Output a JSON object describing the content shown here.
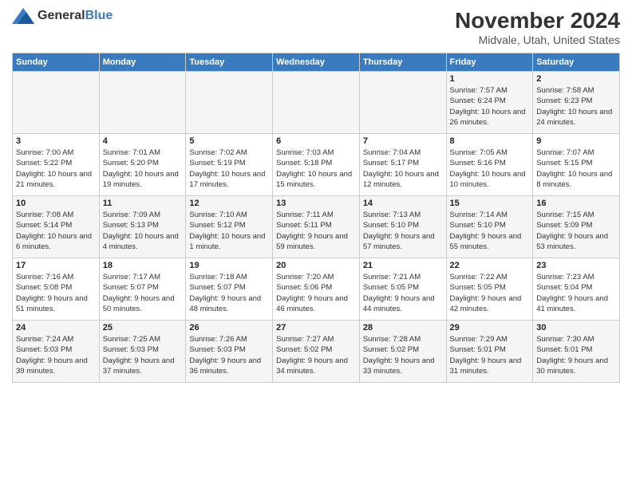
{
  "header": {
    "logo_general": "General",
    "logo_blue": "Blue",
    "month_year": "November 2024",
    "location": "Midvale, Utah, United States"
  },
  "days_of_week": [
    "Sunday",
    "Monday",
    "Tuesday",
    "Wednesday",
    "Thursday",
    "Friday",
    "Saturday"
  ],
  "weeks": [
    [
      {
        "day": "",
        "sunrise": "",
        "sunset": "",
        "daylight": ""
      },
      {
        "day": "",
        "sunrise": "",
        "sunset": "",
        "daylight": ""
      },
      {
        "day": "",
        "sunrise": "",
        "sunset": "",
        "daylight": ""
      },
      {
        "day": "",
        "sunrise": "",
        "sunset": "",
        "daylight": ""
      },
      {
        "day": "",
        "sunrise": "",
        "sunset": "",
        "daylight": ""
      },
      {
        "day": "1",
        "sunrise": "Sunrise: 7:57 AM",
        "sunset": "Sunset: 6:24 PM",
        "daylight": "Daylight: 10 hours and 26 minutes."
      },
      {
        "day": "2",
        "sunrise": "Sunrise: 7:58 AM",
        "sunset": "Sunset: 6:23 PM",
        "daylight": "Daylight: 10 hours and 24 minutes."
      }
    ],
    [
      {
        "day": "3",
        "sunrise": "Sunrise: 7:00 AM",
        "sunset": "Sunset: 5:22 PM",
        "daylight": "Daylight: 10 hours and 21 minutes."
      },
      {
        "day": "4",
        "sunrise": "Sunrise: 7:01 AM",
        "sunset": "Sunset: 5:20 PM",
        "daylight": "Daylight: 10 hours and 19 minutes."
      },
      {
        "day": "5",
        "sunrise": "Sunrise: 7:02 AM",
        "sunset": "Sunset: 5:19 PM",
        "daylight": "Daylight: 10 hours and 17 minutes."
      },
      {
        "day": "6",
        "sunrise": "Sunrise: 7:03 AM",
        "sunset": "Sunset: 5:18 PM",
        "daylight": "Daylight: 10 hours and 15 minutes."
      },
      {
        "day": "7",
        "sunrise": "Sunrise: 7:04 AM",
        "sunset": "Sunset: 5:17 PM",
        "daylight": "Daylight: 10 hours and 12 minutes."
      },
      {
        "day": "8",
        "sunrise": "Sunrise: 7:05 AM",
        "sunset": "Sunset: 5:16 PM",
        "daylight": "Daylight: 10 hours and 10 minutes."
      },
      {
        "day": "9",
        "sunrise": "Sunrise: 7:07 AM",
        "sunset": "Sunset: 5:15 PM",
        "daylight": "Daylight: 10 hours and 8 minutes."
      }
    ],
    [
      {
        "day": "10",
        "sunrise": "Sunrise: 7:08 AM",
        "sunset": "Sunset: 5:14 PM",
        "daylight": "Daylight: 10 hours and 6 minutes."
      },
      {
        "day": "11",
        "sunrise": "Sunrise: 7:09 AM",
        "sunset": "Sunset: 5:13 PM",
        "daylight": "Daylight: 10 hours and 4 minutes."
      },
      {
        "day": "12",
        "sunrise": "Sunrise: 7:10 AM",
        "sunset": "Sunset: 5:12 PM",
        "daylight": "Daylight: 10 hours and 1 minute."
      },
      {
        "day": "13",
        "sunrise": "Sunrise: 7:11 AM",
        "sunset": "Sunset: 5:11 PM",
        "daylight": "Daylight: 9 hours and 59 minutes."
      },
      {
        "day": "14",
        "sunrise": "Sunrise: 7:13 AM",
        "sunset": "Sunset: 5:10 PM",
        "daylight": "Daylight: 9 hours and 57 minutes."
      },
      {
        "day": "15",
        "sunrise": "Sunrise: 7:14 AM",
        "sunset": "Sunset: 5:10 PM",
        "daylight": "Daylight: 9 hours and 55 minutes."
      },
      {
        "day": "16",
        "sunrise": "Sunrise: 7:15 AM",
        "sunset": "Sunset: 5:09 PM",
        "daylight": "Daylight: 9 hours and 53 minutes."
      }
    ],
    [
      {
        "day": "17",
        "sunrise": "Sunrise: 7:16 AM",
        "sunset": "Sunset: 5:08 PM",
        "daylight": "Daylight: 9 hours and 51 minutes."
      },
      {
        "day": "18",
        "sunrise": "Sunrise: 7:17 AM",
        "sunset": "Sunset: 5:07 PM",
        "daylight": "Daylight: 9 hours and 50 minutes."
      },
      {
        "day": "19",
        "sunrise": "Sunrise: 7:18 AM",
        "sunset": "Sunset: 5:07 PM",
        "daylight": "Daylight: 9 hours and 48 minutes."
      },
      {
        "day": "20",
        "sunrise": "Sunrise: 7:20 AM",
        "sunset": "Sunset: 5:06 PM",
        "daylight": "Daylight: 9 hours and 46 minutes."
      },
      {
        "day": "21",
        "sunrise": "Sunrise: 7:21 AM",
        "sunset": "Sunset: 5:05 PM",
        "daylight": "Daylight: 9 hours and 44 minutes."
      },
      {
        "day": "22",
        "sunrise": "Sunrise: 7:22 AM",
        "sunset": "Sunset: 5:05 PM",
        "daylight": "Daylight: 9 hours and 42 minutes."
      },
      {
        "day": "23",
        "sunrise": "Sunrise: 7:23 AM",
        "sunset": "Sunset: 5:04 PM",
        "daylight": "Daylight: 9 hours and 41 minutes."
      }
    ],
    [
      {
        "day": "24",
        "sunrise": "Sunrise: 7:24 AM",
        "sunset": "Sunset: 5:03 PM",
        "daylight": "Daylight: 9 hours and 39 minutes."
      },
      {
        "day": "25",
        "sunrise": "Sunrise: 7:25 AM",
        "sunset": "Sunset: 5:03 PM",
        "daylight": "Daylight: 9 hours and 37 minutes."
      },
      {
        "day": "26",
        "sunrise": "Sunrise: 7:26 AM",
        "sunset": "Sunset: 5:03 PM",
        "daylight": "Daylight: 9 hours and 36 minutes."
      },
      {
        "day": "27",
        "sunrise": "Sunrise: 7:27 AM",
        "sunset": "Sunset: 5:02 PM",
        "daylight": "Daylight: 9 hours and 34 minutes."
      },
      {
        "day": "28",
        "sunrise": "Sunrise: 7:28 AM",
        "sunset": "Sunset: 5:02 PM",
        "daylight": "Daylight: 9 hours and 33 minutes."
      },
      {
        "day": "29",
        "sunrise": "Sunrise: 7:29 AM",
        "sunset": "Sunset: 5:01 PM",
        "daylight": "Daylight: 9 hours and 31 minutes."
      },
      {
        "day": "30",
        "sunrise": "Sunrise: 7:30 AM",
        "sunset": "Sunset: 5:01 PM",
        "daylight": "Daylight: 9 hours and 30 minutes."
      }
    ]
  ]
}
